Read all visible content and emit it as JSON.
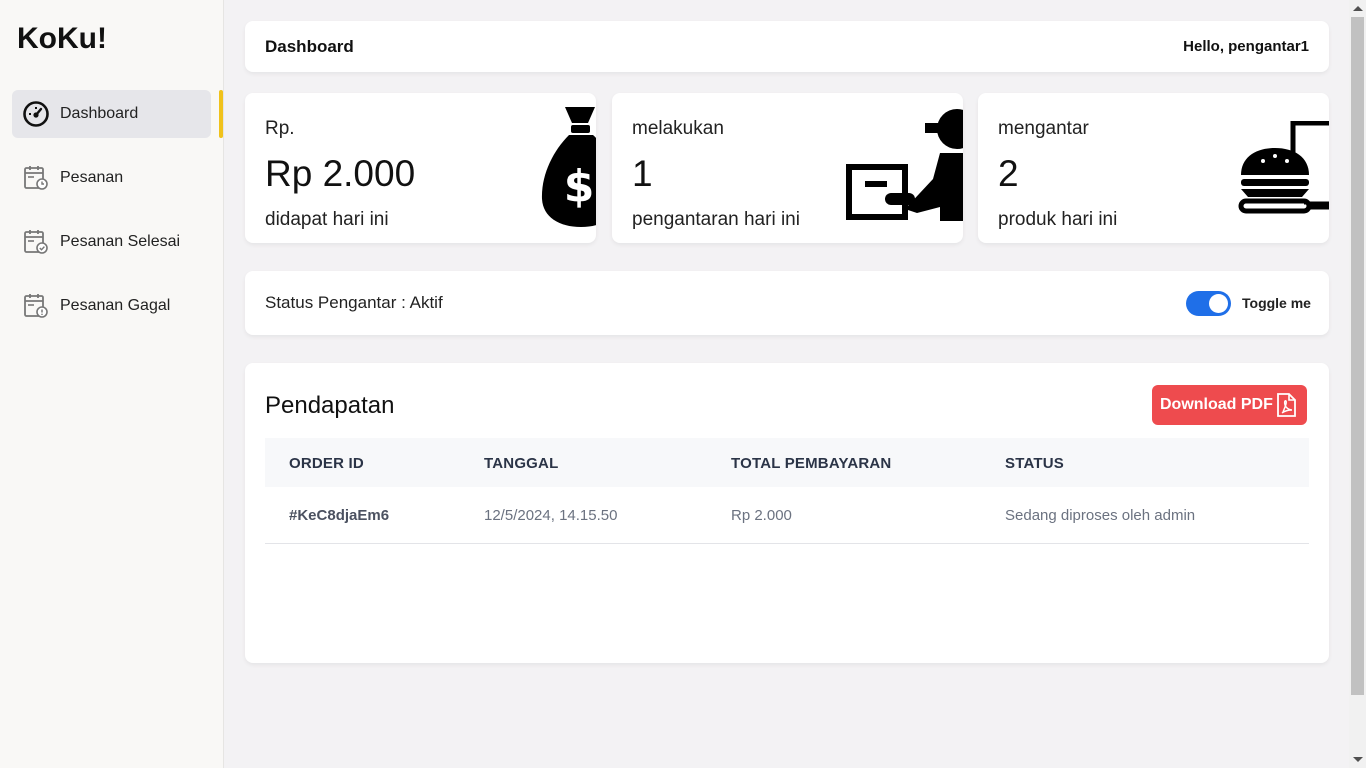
{
  "sidebar": {
    "brand": "KoKu!",
    "items": [
      {
        "label": "Dashboard",
        "icon": "speedometer-icon",
        "active": true
      },
      {
        "label": "Pesanan",
        "icon": "calendar-clock-icon"
      },
      {
        "label": "Pesanan Selesai",
        "icon": "calendar-check-icon"
      },
      {
        "label": "Pesanan Gagal",
        "icon": "calendar-alert-icon"
      }
    ],
    "accent": "#f0c21b"
  },
  "header": {
    "title": "Dashboard",
    "greeting": "Hello, pengantar1"
  },
  "stats": [
    {
      "label": "Rp.",
      "value": "Rp 2.000",
      "sub": "didapat hari ini",
      "icon": "money-bag-icon"
    },
    {
      "label": "melakukan",
      "value": "1",
      "sub": "pengantaran hari ini",
      "icon": "courier-box-icon"
    },
    {
      "label": "mengantar",
      "value": "2",
      "sub": "produk hari ini",
      "icon": "burger-drink-icon"
    }
  ],
  "status": {
    "text": "Status Pengantar : Aktif",
    "toggle_label": "Toggle me",
    "toggle_on": true,
    "toggle_color": "#1f6fe8"
  },
  "earnings": {
    "title": "Pendapatan",
    "download_label": "Download PDF",
    "download_color": "#ee4b4e",
    "columns": [
      "ORDER ID",
      "TANGGAL",
      "TOTAL PEMBAYARAN",
      "STATUS"
    ],
    "rows": [
      [
        "#KeC8djaEm6",
        "12/5/2024, 14.15.50",
        "Rp 2.000",
        "Sedang diproses oleh admin"
      ]
    ]
  }
}
